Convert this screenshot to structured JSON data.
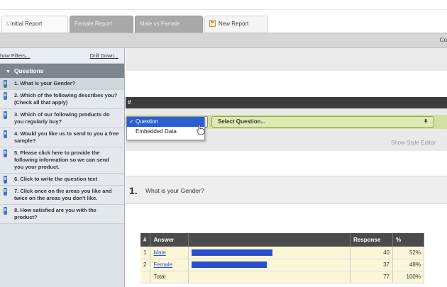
{
  "tabs": [
    {
      "prefix": "fₓ",
      "label": "Initial Report"
    },
    {
      "label": "Female Report"
    },
    {
      "label": "Male vs Female"
    },
    {
      "label": "New Report"
    }
  ],
  "toolbar": {
    "right_text": "Co"
  },
  "sidebar": {
    "links": {
      "left": "how Filters...",
      "right": "Drill Down..."
    },
    "section_title": "Questions",
    "questions": [
      "1. What is your Gender?",
      "2. Which of the following describes you? (Check all that apply)",
      "3. Which of our following products do you regularly buy?",
      "4. Would you like us to send to you a free sample?",
      "5. Please click here to provide the following information so we can send you your product.",
      "6. Click to write the question text",
      "7. Click once on the areas you like and twice on the areas you don't like.",
      "8. How satisfied are you with the product?"
    ]
  },
  "editor": {
    "darkbar_text": "#",
    "type_menu": {
      "options": [
        "Question",
        "Embedded Data"
      ],
      "selected": "Question"
    },
    "question_select": "Select Question...",
    "style_link": "Show Style Editor"
  },
  "question": {
    "number": "1.",
    "text": "What is your Gender?"
  },
  "results": {
    "headers": [
      "#",
      "Answer",
      "",
      "Response",
      "%"
    ],
    "rows": [
      {
        "n": "1",
        "answer": "Male",
        "fraction": 0.52,
        "response": "40",
        "pct": "52%"
      },
      {
        "n": "2",
        "answer": "Female",
        "fraction": 0.48,
        "response": "37",
        "pct": "48%"
      }
    ],
    "total": {
      "label": "Total",
      "response": "77",
      "pct": "100%"
    }
  },
  "colors": {
    "bar": "#2c4ec9",
    "menu_highlight": "#2a5fd1",
    "green_bar": "#d3e09f"
  }
}
